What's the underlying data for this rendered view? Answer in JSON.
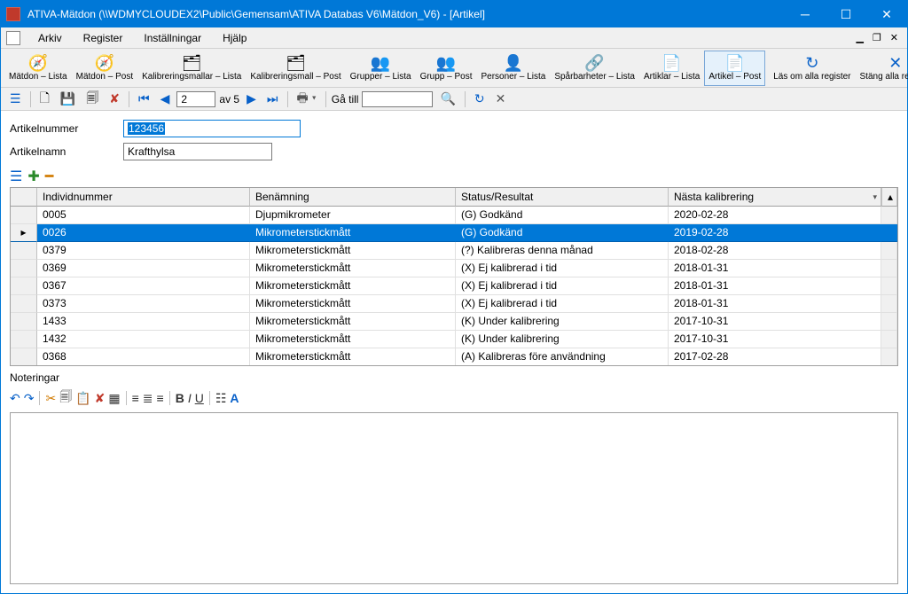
{
  "titlebar": {
    "title": "ATIVA-Mätdon (\\\\WDMYCLOUDEX2\\Public\\Gemensam\\ATIVA Databas V6\\Mätdon_V6) - [Artikel]"
  },
  "menubar": {
    "items": [
      "Arkiv",
      "Register",
      "Inställningar",
      "Hjälp"
    ]
  },
  "toolbar_main": [
    {
      "label": "Mätdon – Lista",
      "icon": "🧭"
    },
    {
      "label": "Mätdon – Post",
      "icon": "🧭"
    },
    {
      "label": "Kalibreringsmallar – Lista",
      "icon": "🗂"
    },
    {
      "label": "Kalibreringsmall – Post",
      "icon": "🗂"
    },
    {
      "label": "Grupper – Lista",
      "icon": "👥"
    },
    {
      "label": "Grupp – Post",
      "icon": "👥"
    },
    {
      "label": "Personer – Lista",
      "icon": "👤"
    },
    {
      "label": "Spårbarheter – Lista",
      "icon": "🔗"
    },
    {
      "label": "Artiklar – Lista",
      "icon": "📄"
    },
    {
      "label": "Artikel – Post",
      "icon": "📄",
      "active": true
    }
  ],
  "toolbar_right": [
    {
      "label": "Läs om alla register",
      "icon": "↻"
    },
    {
      "label": "Stäng alla register",
      "icon": "✕"
    }
  ],
  "recordbar": {
    "page_value": "2",
    "page_total_prefix": "av",
    "page_total": "5",
    "goto_label": "Gå till"
  },
  "form": {
    "artikelnummer_label": "Artikelnummer",
    "artikelnummer_value": "123456",
    "artikelnamn_label": "Artikelnamn",
    "artikelnamn_value": "Krafthylsa"
  },
  "grid": {
    "headers": [
      "Individnummer",
      "Benämning",
      "Status/Resultat",
      "Nästa kalibrering"
    ],
    "rows": [
      {
        "id": "0005",
        "ben": "Djupmikrometer",
        "status": "(G) Godkänd",
        "date": "2020-02-28"
      },
      {
        "id": "0026",
        "ben": "Mikrometerstickmått",
        "status": "(G) Godkänd",
        "date": "2019-02-28",
        "selected": true
      },
      {
        "id": "0379",
        "ben": "Mikrometerstickmått",
        "status": "(?) Kalibreras denna månad",
        "date": "2018-02-28"
      },
      {
        "id": "0369",
        "ben": "Mikrometerstickmått",
        "status": "(X) Ej kalibrerad i tid",
        "date": "2018-01-31"
      },
      {
        "id": "0367",
        "ben": "Mikrometerstickmått",
        "status": "(X) Ej kalibrerad i tid",
        "date": "2018-01-31"
      },
      {
        "id": "0373",
        "ben": "Mikrometerstickmått",
        "status": "(X) Ej kalibrerad i tid",
        "date": "2018-01-31"
      },
      {
        "id": "1433",
        "ben": "Mikrometerstickmått",
        "status": "(K) Under kalibrering",
        "date": "2017-10-31"
      },
      {
        "id": "1432",
        "ben": "Mikrometerstickmått",
        "status": "(K) Under kalibrering",
        "date": "2017-10-31"
      },
      {
        "id": "0368",
        "ben": "Mikrometerstickmått",
        "status": "(A) Kalibreras före användning",
        "date": "2017-02-28"
      }
    ]
  },
  "notes": {
    "label": "Noteringar"
  }
}
